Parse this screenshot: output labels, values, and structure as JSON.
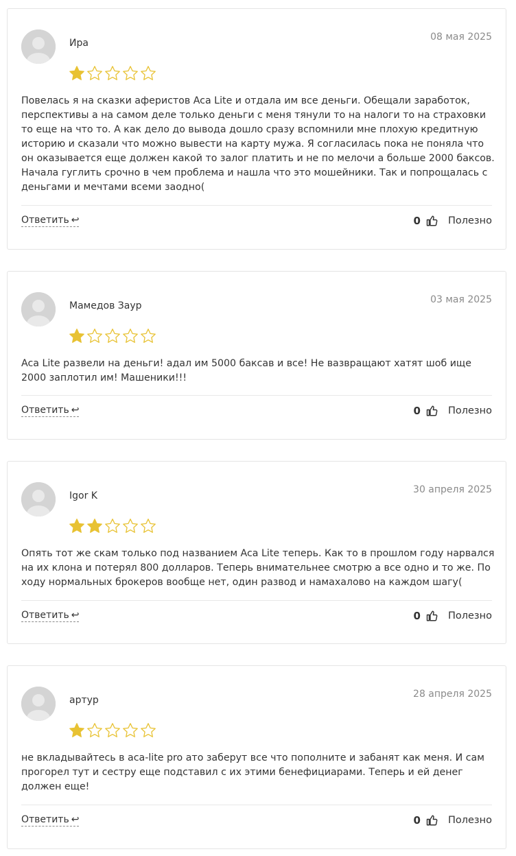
{
  "star_colors": {
    "filled": "#e8c233",
    "empty_outline": "#e8c233"
  },
  "reviews": [
    {
      "author": "Ира",
      "date": "08 мая 2025",
      "rating": 1,
      "text": "Повелась я на сказки аферистов Aca Lite и отдала им все деньги. Обещали заработок, перспективы а на самом деле только деньги с меня тянули то на налоги то на страховки то еще на что то. А как дело до вывода дошло сразу вспомнили мне плохую кредитную историю и сказали что можно вывести на карту мужа. Я согласилась пока не поняла что он оказывается еще должен какой то залог платить и не по мелочи а больше 2000 баксов. Начала гуглить срочно в чем проблема и нашла что это мошейники. Так и попрощалась с деньгами и мечтами всеми заодно(",
      "reply_label": "Ответить",
      "reply_arrow": "↩",
      "helpful_count": "0",
      "helpful_label": "Полезно"
    },
    {
      "author": "Мамедов Заур",
      "date": "03 мая 2025",
      "rating": 1,
      "text": "Aca Lite развели на деньги! адал им 5000 баксав и все! Не вазвращают хатят шоб ище 2000 заплотил им! Машеники!!!",
      "reply_label": "Ответить",
      "reply_arrow": "↩",
      "helpful_count": "0",
      "helpful_label": "Полезно"
    },
    {
      "author": "Igor K",
      "date": "30 апреля 2025",
      "rating": 2,
      "text": "Опять тот же скам только под названием Aca Lite теперь. Как то в прошлом году нарвался на их клона и потерял 800 долларов. Теперь внимательнее смотрю а все одно и то же. По ходу нормальных брокеров вообще нет, один развод и намахалово на каждом шагу(",
      "reply_label": "Ответить",
      "reply_arrow": "↩",
      "helpful_count": "0",
      "helpful_label": "Полезно"
    },
    {
      "author": "артур",
      "date": "28 апреля 2025",
      "rating": 1,
      "text": "не вкладывайтесь в aca-lite pro ато заберут все что пополните и забанят как меня. И сам прогорел тут и сестру еще подставил с их этими бенефициарами. Теперь и ей денег должен еще!",
      "reply_label": "Ответить",
      "reply_arrow": "↩",
      "helpful_count": "0",
      "helpful_label": "Полезно"
    }
  ]
}
